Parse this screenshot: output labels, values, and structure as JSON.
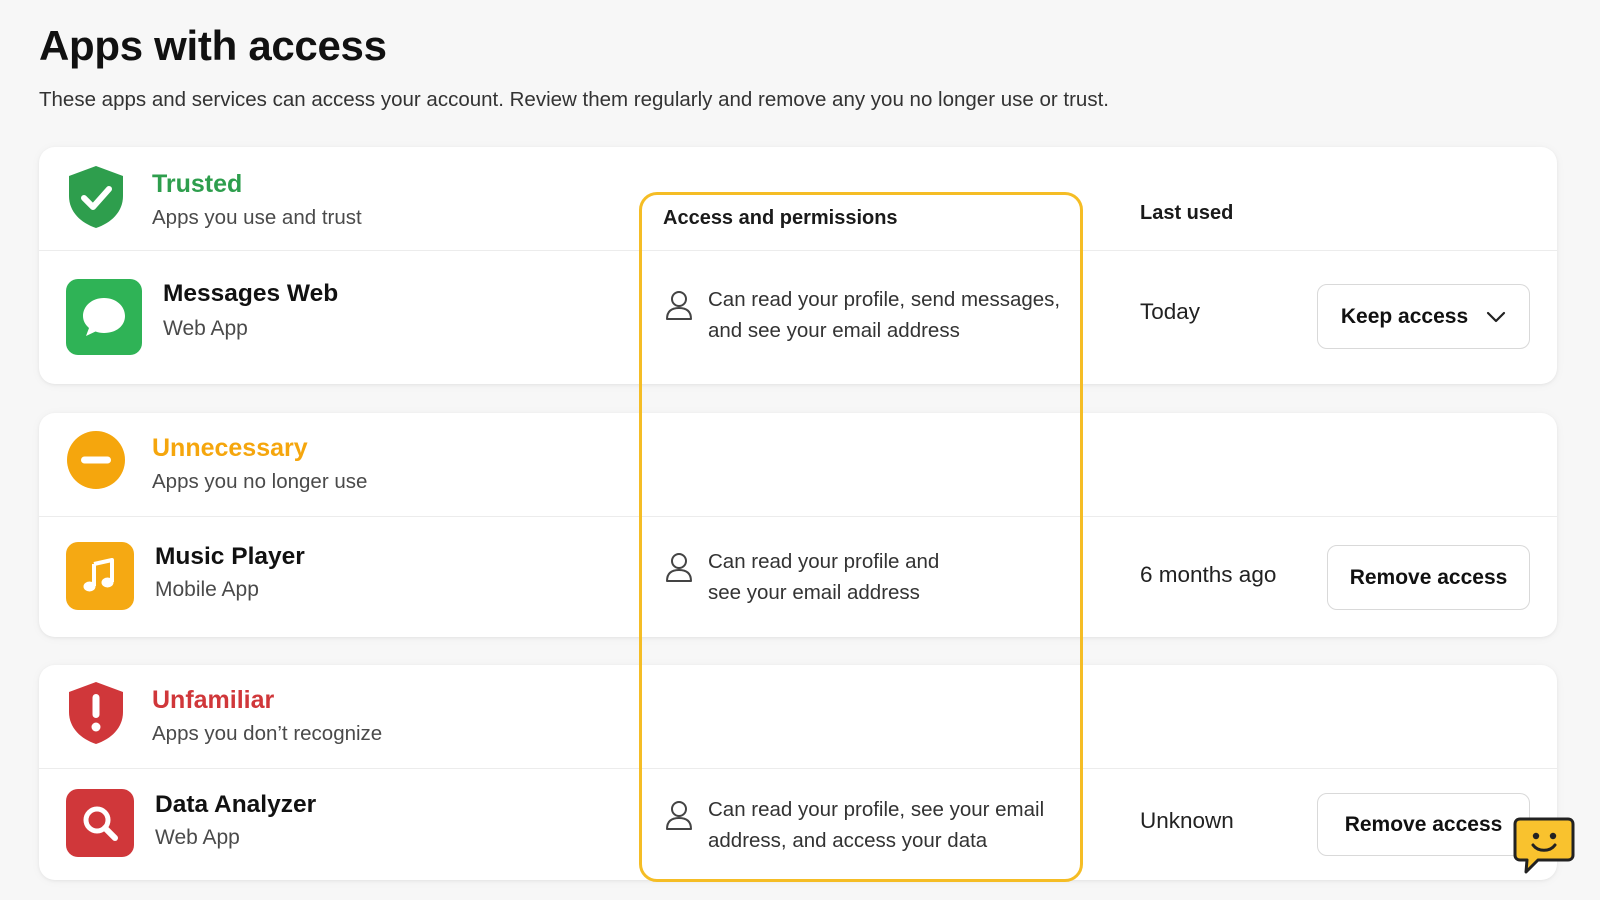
{
  "header": {
    "title": "Apps with access",
    "subtitle": "These apps and services can access your account. Review them regularly and remove any you no longer use or trust."
  },
  "columns": {
    "permissions": "Access and permissions",
    "last_used": "Last used"
  },
  "colors": {
    "trusted": "#2e9e4d",
    "unnecessary": "#f5a60d",
    "unfamiliar": "#d0373a",
    "highlight": "#f5bd25"
  },
  "sections": [
    {
      "category": "Trusted",
      "description": "Apps you use and trust",
      "icon": "shield-check-icon",
      "app": {
        "name": "Messages Web",
        "type": "Web App",
        "icon": "chat-bubble-icon",
        "permissions": "Can read your profile, send messages, and see your email address",
        "last_used": "Today",
        "action": "Keep access",
        "action_icon": "chevron-down-icon"
      }
    },
    {
      "category": "Unnecessary",
      "description": "Apps you no longer use",
      "icon": "minus-circle-icon",
      "app": {
        "name": "Music Player",
        "type": "Mobile App",
        "icon": "music-note-icon",
        "permissions": "Can read your profile and see your email address",
        "last_used": "6 months ago",
        "action": "Remove access"
      }
    },
    {
      "category": "Unfamiliar",
      "description": "Apps you don’t recognize",
      "icon": "shield-alert-icon",
      "app": {
        "name": "Data Analyzer",
        "type": "Web App",
        "icon": "magnifier-icon",
        "permissions": "Can read your profile, see your email address, and access your data",
        "last_used": "Unknown",
        "action": "Remove access"
      }
    }
  ],
  "assistant": {
    "icon": "smiley-chat-icon"
  }
}
